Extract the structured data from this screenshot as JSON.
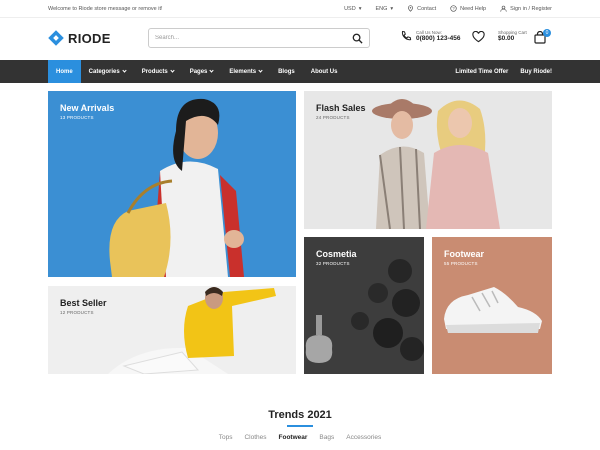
{
  "topbar": {
    "welcome": "Welcome to Riode store message or remove it!",
    "currency": "USD",
    "language": "ENG",
    "contact": "Contact",
    "help": "Need Help",
    "signin": "Sign in / Register"
  },
  "header": {
    "logo": "RIODE",
    "search_placeholder": "Search...",
    "call_label": "Call Us Now:",
    "call_number": "0(800) 123-456",
    "cart_label": "Shopping Cart",
    "cart_total": "$0.00",
    "cart_count": "0"
  },
  "nav": {
    "items": [
      {
        "label": "Home"
      },
      {
        "label": "Categories"
      },
      {
        "label": "Pages"
      },
      {
        "label": "Pages"
      },
      {
        "label": "Elements"
      },
      {
        "label": "Blogs"
      },
      {
        "label": "About Us"
      }
    ],
    "right": [
      "Limited Time Offer",
      "Buy Riode!"
    ]
  },
  "banners": {
    "new_arrivals": {
      "title": "New Arrivals",
      "count": "13 PRODUCTS"
    },
    "flash_sales": {
      "title": "Flash Sales",
      "count": "24 PRODUCTS"
    },
    "best_seller": {
      "title": "Best Seller",
      "count": "12 PRODUCTS"
    },
    "cosmetia": {
      "title": "Cosmetia",
      "count": "32 PRODUCTS"
    },
    "footwear": {
      "title": "Footwear",
      "count": "55 PRODUCTS"
    }
  },
  "trends": {
    "title": "Trends 2021",
    "tabs": [
      "Tops",
      "Clothes",
      "Footwear",
      "Bags",
      "Accessories"
    ],
    "active_tab": "Footwear"
  },
  "colors": {
    "accent": "#2b8fde",
    "nav_bg": "#333333"
  }
}
